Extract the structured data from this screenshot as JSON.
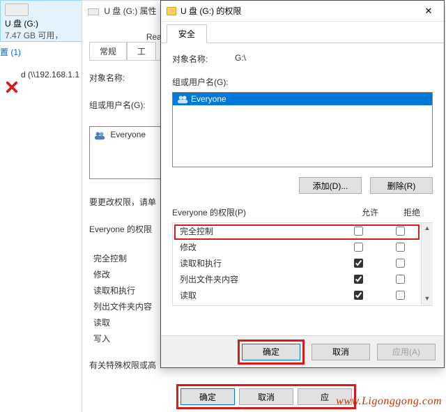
{
  "explorer": {
    "drive_label": "U 盘 (G:)",
    "capacity_text": "7.47 GB 可用，",
    "config_link": "置 (1)",
    "network_item": "d (\\\\192.168.1.1"
  },
  "props_back": {
    "title": "U 盘 (G:) 属性",
    "ready": "ReadyBoost",
    "tabs": [
      "常规",
      "工"
    ],
    "object_label": "对象名称:",
    "group_label": "组或用户名(G):",
    "list_item": "Everyone",
    "change_hint": "要更改权限，请单",
    "perm_header": "Everyone 的权限",
    "perm_rows": [
      "完全控制",
      "修改",
      "读取和执行",
      "列出文件夹内容",
      "读取",
      "写入"
    ],
    "special_hint": "有关特殊权限或高",
    "ok": "确定",
    "cancel": "取消",
    "apply": "应"
  },
  "perm": {
    "title": "U 盘 (G:) 的权限",
    "tab": "安全",
    "object_label": "对象名称:",
    "object_value": "G:\\",
    "group_label": "组或用户名(G):",
    "list_item": "Everyone",
    "add": "添加(D)...",
    "del": "删除(R)",
    "perm_header": "Everyone 的权限(P)",
    "col_allow": "允许",
    "col_deny": "拒绝",
    "rows": [
      {
        "name": "完全控制",
        "allow": false,
        "deny": false
      },
      {
        "name": "修改",
        "allow": false,
        "deny": false
      },
      {
        "name": "读取和执行",
        "allow": true,
        "deny": false
      },
      {
        "name": "列出文件夹内容",
        "allow": true,
        "deny": false
      },
      {
        "name": "读取",
        "allow": true,
        "deny": false
      }
    ],
    "ok": "确定",
    "cancel": "取消",
    "apply": "应用(A)"
  },
  "watermark": "www.Ligonggong.com"
}
